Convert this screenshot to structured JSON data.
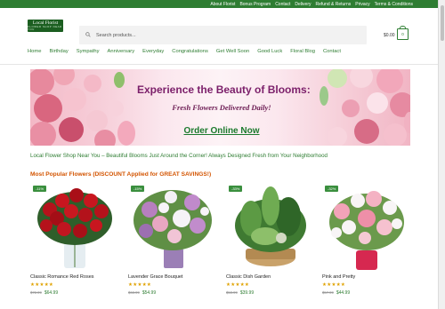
{
  "topbar": {
    "links": [
      "About Florist",
      "Bonus Program",
      "Contact",
      "Delivery",
      "Refund & Returns",
      "Privacy",
      "Terms & Conditions"
    ]
  },
  "header": {
    "logo_text": "Local Florist",
    "logo_tagline": "FLOWER SHOP NEAR YOU",
    "search_placeholder": "Search products...",
    "cart_total": "$0.00",
    "cart_count": "0"
  },
  "nav": {
    "items": [
      "Home",
      "Birthday",
      "Sympathy",
      "Anniversary",
      "Everyday",
      "Congratulations",
      "Get Well Soon",
      "Good Luck",
      "Floral Blog",
      "Contact"
    ]
  },
  "banner": {
    "title": "Experience the Beauty of Blooms:",
    "subtitle": "Fresh Flowers Delivered Daily!",
    "cta": "Order Online Now"
  },
  "tagline": "Local Flower Shop Near You – Beautiful Blooms Just Around the Corner! Always Designed Fresh from Your Neighborhood",
  "section_title": "Most Popular Flowers (DISCOUNT Applied for GREAT SAVINGS!)",
  "products": [
    {
      "name": "Classic Romance Red Roses",
      "badge": "-11%",
      "stars": "★★★★★",
      "old_price": "$72.99",
      "price": "$64.99"
    },
    {
      "name": "Lavender Grace Bouquet",
      "badge": "-15%",
      "stars": "★★★★★",
      "old_price": "$63.99",
      "price": "$54.99"
    },
    {
      "name": "Classic Dish Garden",
      "badge": "-33%",
      "stars": "★★★★★",
      "old_price": "$58.99",
      "price": "$39.99"
    },
    {
      "name": "Pink and Pretty",
      "badge": "-32%",
      "stars": "★★★★★",
      "old_price": "$57.99",
      "price": "$44.99"
    }
  ],
  "colors": {
    "brand_green": "#2e7d32",
    "section_orange": "#d35400",
    "banner_title": "#7b1f6a",
    "star": "#e0a200"
  }
}
